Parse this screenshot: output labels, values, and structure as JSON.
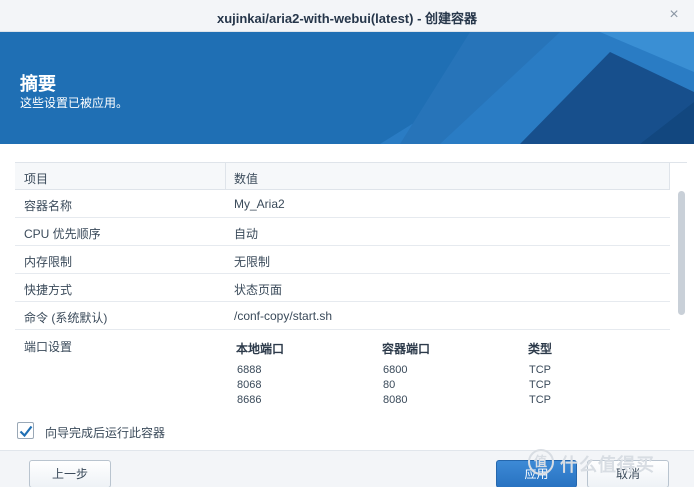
{
  "window": {
    "title": "xujinkai/aria2-with-webui(latest) - 创建容器",
    "close_icon": "×"
  },
  "banner": {
    "heading": "摘要",
    "subheading": "这些设置已被应用。",
    "colors": {
      "base": "#1f6fb4",
      "dark": "#174f8c",
      "light": "#3a8fd4"
    }
  },
  "table": {
    "columns": [
      "项目",
      "数值"
    ],
    "rows": [
      {
        "key": "容器名称",
        "value": "My_Aria2"
      },
      {
        "key": "CPU 优先顺序",
        "value": "自动"
      },
      {
        "key": "内存限制",
        "value": "无限制"
      },
      {
        "key": "快捷方式",
        "value": "状态页面"
      },
      {
        "key": "命令 (系统默认)",
        "value": "/conf-copy/start.sh"
      }
    ],
    "ports": {
      "key": "端口设置",
      "headers": [
        "本地端口",
        "容器端口",
        "类型"
      ],
      "entries": [
        [
          "6888",
          "6800",
          "TCP"
        ],
        [
          "8068",
          "80",
          "TCP"
        ],
        [
          "8686",
          "8080",
          "TCP"
        ]
      ]
    }
  },
  "options": {
    "run_after_wizard": {
      "label": "向导完成后运行此容器",
      "checked": true
    }
  },
  "footer": {
    "back_label": "上一步",
    "apply_label": "应用",
    "cancel_label": "取消"
  },
  "watermark": {
    "icon_text": "值",
    "text": "什么值得买"
  }
}
